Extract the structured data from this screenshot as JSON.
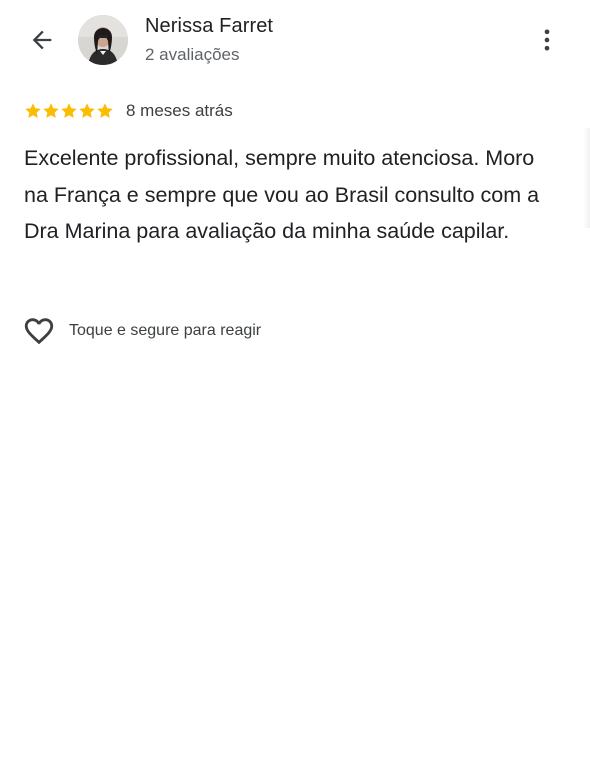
{
  "reviewer": {
    "name": "Nerissa Farret",
    "review_count": "2 avaliações"
  },
  "review": {
    "rating": 5,
    "rating_max": 5,
    "date": "8 meses atrás",
    "text": "Excelente profissional, sempre muito atenciosa. Moro na França e sempre que vou ao Brasil consulto com a Dra Marina para avaliação da minha saúde capilar."
  },
  "reaction": {
    "label": "Toque e segure para reagir"
  },
  "icons": {
    "back": "arrow-back-icon",
    "more": "more-vert-icon",
    "star": "star-icon",
    "heart": "heart-outline-icon"
  },
  "colors": {
    "star": "#fbbc04",
    "icon": "#3c4043",
    "text_primary": "#202124",
    "text_secondary": "#5f6368"
  }
}
